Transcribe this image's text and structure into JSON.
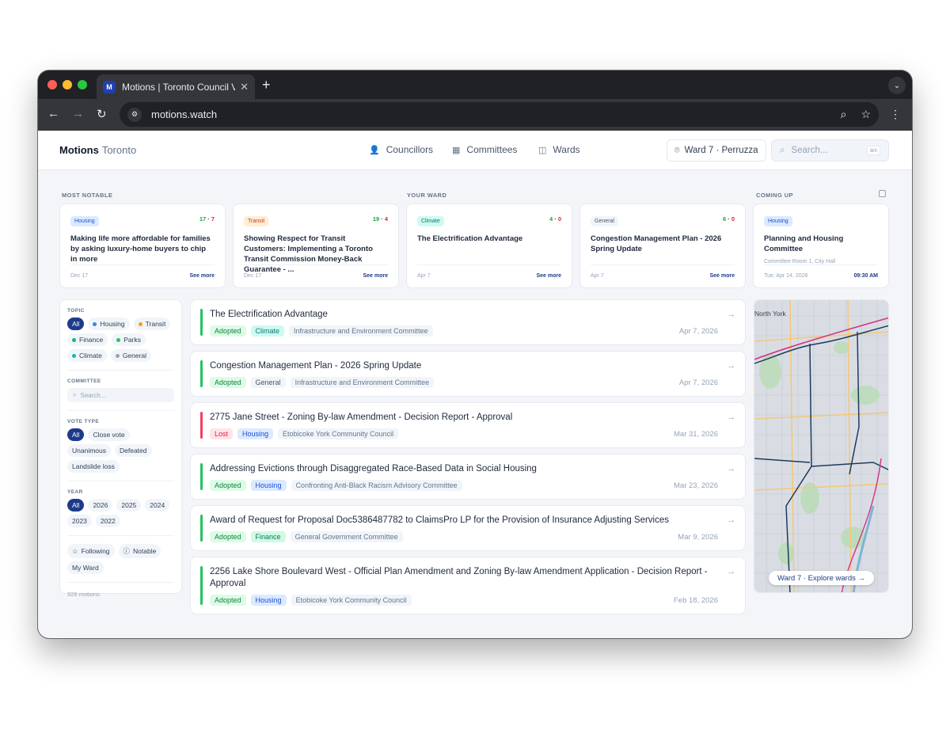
{
  "browser": {
    "tab_title": "Motions | Toronto Council Vot",
    "favicon_letter": "M",
    "url": "motions.watch"
  },
  "header": {
    "brand": "Motions",
    "city": "Toronto",
    "nav": [
      {
        "label": "Councillors",
        "icon": "users-icon"
      },
      {
        "label": "Committees",
        "icon": "building-icon"
      },
      {
        "label": "Wards",
        "icon": "map-icon"
      }
    ],
    "ward_button": "Ward 7 · Perruzza",
    "search_placeholder": "Search...",
    "shortcut": "⌘K"
  },
  "sections": {
    "most_notable": "MOST NOTABLE",
    "your_ward": "YOUR WARD",
    "coming_up": "COMING UP"
  },
  "cards": [
    {
      "topic": "Housing",
      "yes": "17",
      "no": "7",
      "title": "Making life more affordable for families by asking luxury-home buyers to chip in more",
      "date": "Dec 17",
      "link": "See more"
    },
    {
      "topic": "Transit",
      "yes": "19",
      "no": "4",
      "title": "Showing Respect for Transit Customers: Implementing a Toronto Transit Commission Money-Back Guarantee - ...",
      "date": "Dec 17",
      "link": "See more"
    },
    {
      "topic": "Climate",
      "yes": "4",
      "no": "0",
      "title": "The Electrification Advantage",
      "date": "Apr 7",
      "link": "See more"
    },
    {
      "topic": "General",
      "yes": "6",
      "no": "0",
      "title": "Congestion Management Plan - 2026 Spring Update",
      "date": "Apr 7",
      "link": "See more"
    }
  ],
  "upcoming": {
    "topic": "Housing",
    "title": "Planning and Housing Committee",
    "location": "Committee Room 1, City Hall",
    "date": "Tue, Apr 14, 2026",
    "time": "09:30 AM"
  },
  "filters": {
    "topic_label": "TOPIC",
    "topics": [
      {
        "label": "All",
        "active": true
      },
      {
        "label": "Housing",
        "dot": "#3b82f6"
      },
      {
        "label": "Transit",
        "dot": "#f59e0b"
      },
      {
        "label": "Finance",
        "dot": "#10b981"
      },
      {
        "label": "Parks",
        "dot": "#22c55e"
      },
      {
        "label": "Climate",
        "dot": "#14b8a6"
      },
      {
        "label": "General",
        "dot": "#94a3b8"
      }
    ],
    "committee_label": "COMMITTEE",
    "committee_placeholder": "Search...",
    "vote_type_label": "VOTE TYPE",
    "vote_types": [
      {
        "label": "All",
        "active": true
      },
      {
        "label": "Close vote"
      },
      {
        "label": "Unanimous"
      },
      {
        "label": "Defeated"
      },
      {
        "label": "Landslide loss"
      }
    ],
    "year_label": "YEAR",
    "years": [
      {
        "label": "All",
        "active": true
      },
      {
        "label": "2026"
      },
      {
        "label": "2025"
      },
      {
        "label": "2024"
      },
      {
        "label": "2023"
      },
      {
        "label": "2022"
      }
    ],
    "extras": [
      {
        "label": "Following",
        "icon": "star-icon"
      },
      {
        "label": "Notable",
        "icon": "info-icon"
      },
      {
        "label": "My Ward"
      }
    ],
    "count": "926 motions"
  },
  "motions": [
    {
      "title": "The Electrification Advantage",
      "status": "Adopted",
      "topic": "Climate",
      "committee": "Infrastructure and Environment Committee",
      "date": "Apr 7, 2026"
    },
    {
      "title": "Congestion Management Plan - 2026 Spring Update",
      "status": "Adopted",
      "topic": "General",
      "committee": "Infrastructure and Environment Committee",
      "date": "Apr 7, 2026"
    },
    {
      "title": "2775 Jane Street - Zoning By-law Amendment - Decision Report - Approval",
      "status": "Lost",
      "topic": "Housing",
      "committee": "Etobicoke York Community Council",
      "date": "Mar 31, 2026"
    },
    {
      "title": "Addressing Evictions through Disaggregated Race-Based Data in Social Housing",
      "status": "Adopted",
      "topic": "Housing",
      "committee": "Confronting Anti-Black Racism Advisory Committee",
      "date": "Mar 23, 2026"
    },
    {
      "title": "Award of Request for Proposal Doc5386487782 to ClaimsPro LP for the Provision of Insurance Adjusting Services",
      "status": "Adopted",
      "topic": "Finance",
      "committee": "General Government Committee",
      "date": "Mar 9, 2026"
    },
    {
      "title": "2256 Lake Shore Boulevard West - Official Plan Amendment and Zoning By-law Amendment Application - Decision Report - Approval",
      "status": "Adopted",
      "topic": "Housing",
      "committee": "Etobicoke York Community Council",
      "date": "Feb 18, 2026"
    }
  ],
  "map": {
    "label": "North York",
    "button": "Ward 7 · Explore wards →"
  },
  "colors": {
    "accent": "#1e3a8a",
    "adopted": "#16a34a",
    "lost": "#dc2626"
  }
}
